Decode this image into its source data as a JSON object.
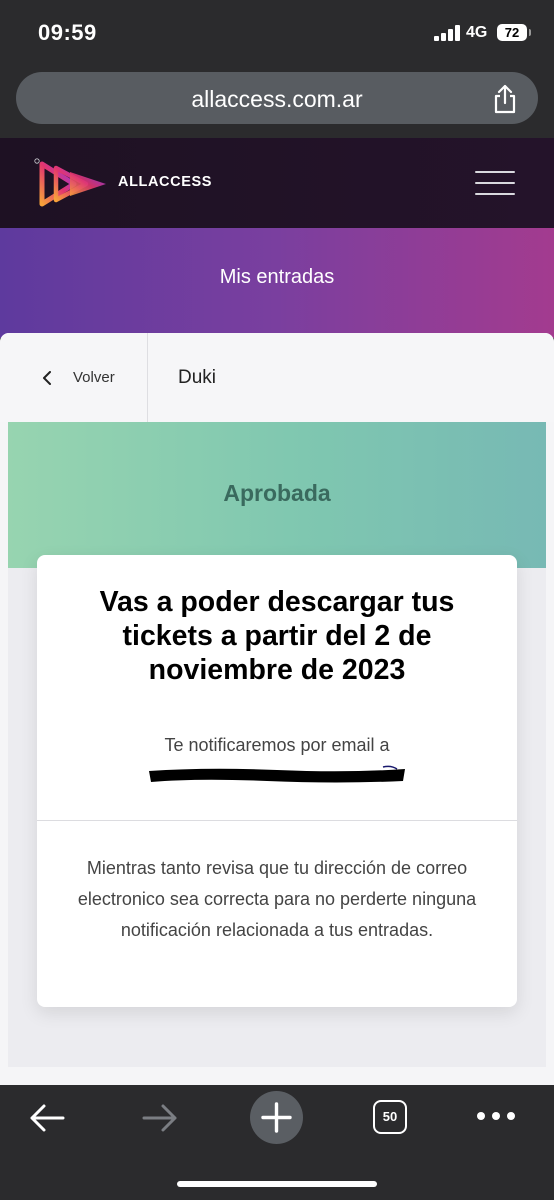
{
  "status_bar": {
    "time": "09:59",
    "network": "4G",
    "battery": "72"
  },
  "browser": {
    "url": "allaccess.com.ar",
    "open_tabs": "50"
  },
  "site": {
    "brand": "ALLACCESS"
  },
  "banner": {
    "title": "Mis entradas"
  },
  "nav": {
    "back_label": "Volver",
    "event_name": "Duki"
  },
  "order": {
    "status": "Aprobada",
    "headline": "Vas a poder descargar tus tickets a partir del 2 de noviembre de 2023",
    "notify_label": "Te notificaremos por email a",
    "info": "Mientras tanto revisa que tu dirección de correo electronico sea correcta para no perderte ninguna notificación relacionada a tus entradas."
  },
  "colors": {
    "status_accent": "#3a6a5e",
    "banner_gradient_start": "#5e3a9e",
    "banner_gradient_end": "#a33b8f",
    "status_band_start": "#97d4b0",
    "status_band_end": "#77b9b4"
  },
  "icons": {
    "share": "share-icon",
    "menu": "hamburger-menu-icon",
    "back": "chevron-left-icon",
    "browser_back": "arrow-left-icon",
    "browser_forward": "arrow-right-icon",
    "new_tab": "plus-icon",
    "more": "more-horizontal-icon"
  }
}
